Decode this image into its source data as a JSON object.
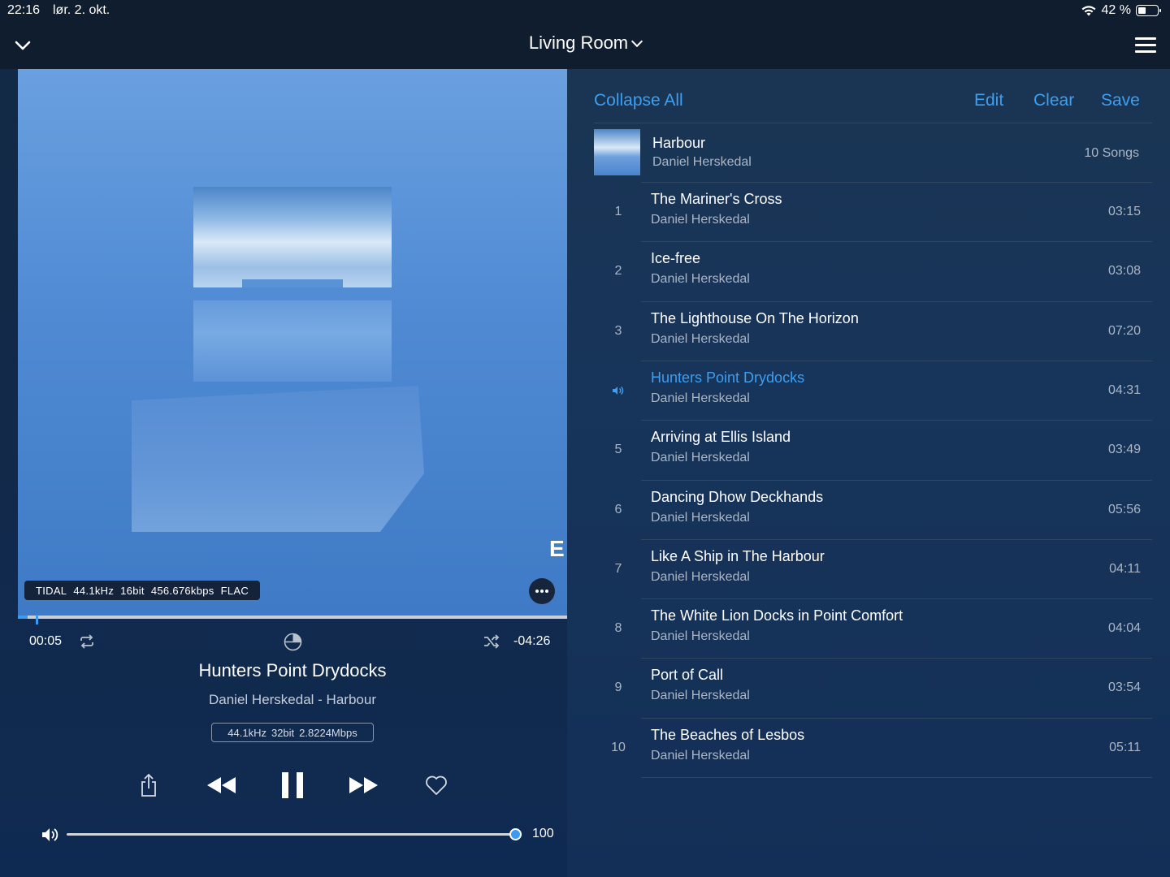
{
  "status_bar": {
    "time": "22:16",
    "date": "lør. 2. okt.",
    "battery": "42 %",
    "battery_level": 0.42
  },
  "header": {
    "room": "Living Room"
  },
  "now_playing": {
    "stream_info": [
      "TIDAL",
      "44.1kHz",
      "16bit",
      "456.676kbps",
      "FLAC"
    ],
    "elapsed": "00:05",
    "remaining": "-04:26",
    "progress_fraction": 0.018,
    "title": "Hunters Point Drydocks",
    "subtitle": "Daniel Herskedal - Harbour",
    "output_quality": [
      "44.1kHz",
      "32bit",
      "2.8224Mbps"
    ],
    "volume": "100",
    "volume_fraction": 1.0
  },
  "queue": {
    "actions": {
      "collapse_all": "Collapse All",
      "edit": "Edit",
      "clear": "Clear",
      "save": "Save"
    },
    "album": {
      "name": "Harbour",
      "artist": "Daniel Herskedal",
      "count": "10 Songs"
    },
    "tracks": [
      {
        "num": "1",
        "title": "The Mariner's Cross",
        "artist": "Daniel Herskedal",
        "duration": "03:15"
      },
      {
        "num": "2",
        "title": "Ice-free",
        "artist": "Daniel Herskedal",
        "duration": "03:08"
      },
      {
        "num": "3",
        "title": "The Lighthouse On The Horizon",
        "artist": "Daniel Herskedal",
        "duration": "07:20"
      },
      {
        "num": "4",
        "title": "Hunters Point Drydocks",
        "artist": "Daniel Herskedal",
        "duration": "04:31",
        "playing": true
      },
      {
        "num": "5",
        "title": "Arriving at Ellis Island",
        "artist": "Daniel Herskedal",
        "duration": "03:49"
      },
      {
        "num": "6",
        "title": "Dancing Dhow Deckhands",
        "artist": "Daniel Herskedal",
        "duration": "05:56"
      },
      {
        "num": "7",
        "title": "Like A Ship in The Harbour",
        "artist": "Daniel Herskedal",
        "duration": "04:11"
      },
      {
        "num": "8",
        "title": "The White Lion Docks in Point Comfort",
        "artist": "Daniel Herskedal",
        "duration": "04:04"
      },
      {
        "num": "9",
        "title": "Port of Call",
        "artist": "Daniel Herskedal",
        "duration": "03:54"
      },
      {
        "num": "10",
        "title": "The Beaches of Lesbos",
        "artist": "Daniel Herskedal",
        "duration": "05:11"
      }
    ]
  },
  "colors": {
    "accent": "#3e9ef0",
    "background": "#132a45",
    "bar": "#101d2e"
  }
}
